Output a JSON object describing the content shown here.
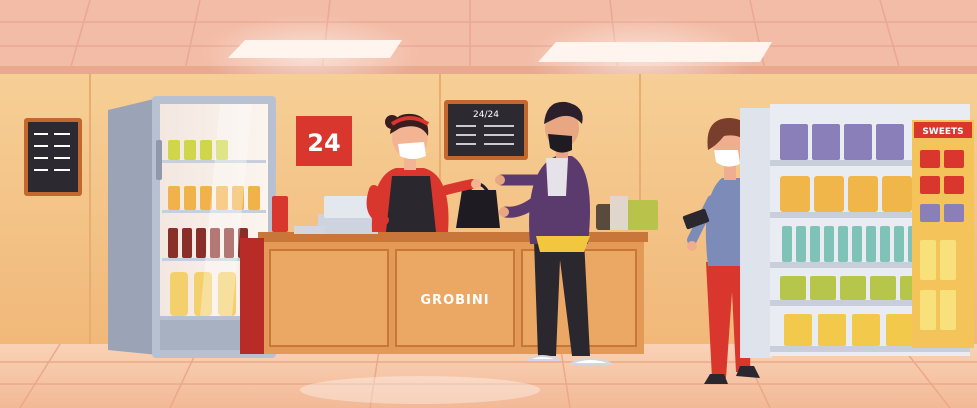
{
  "scene": {
    "red_sign_text": "24",
    "menu_board_title": "24/24",
    "counter_text": "GROBINI",
    "shelf_sign_text": "SWEETS"
  },
  "colors": {
    "ceiling": "#f2b9a3",
    "wall": "#f4c58a",
    "floor": "#f7c9a8",
    "counter_wood": "#e59a55",
    "brand_red": "#d9362e",
    "mask": "#ffffff"
  }
}
